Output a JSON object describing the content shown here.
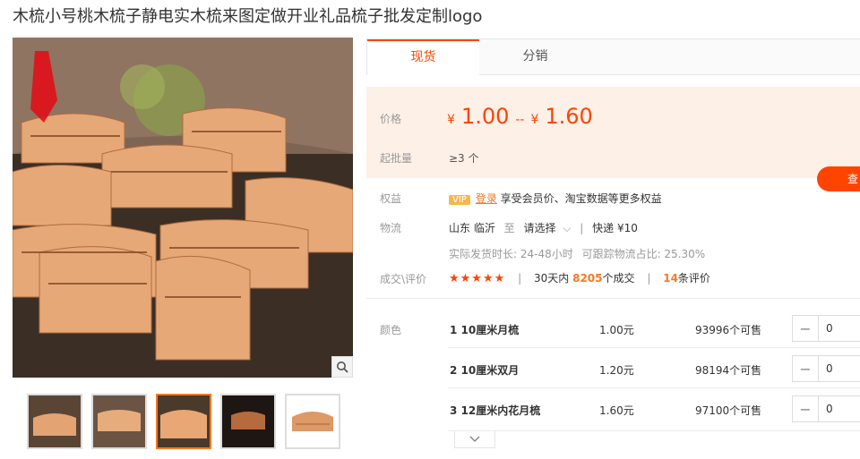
{
  "product": {
    "title": "木梳小号桃木梳子静电实木梳来图定做开业礼品梳子批发定制logo"
  },
  "gallery": {
    "thumb_count": 5,
    "active_index": 2
  },
  "tabs": [
    {
      "label": "现货",
      "active": true
    },
    {
      "label": "分销",
      "active": false
    }
  ],
  "price": {
    "label": "价格",
    "currency": "¥",
    "min": "1.00",
    "max": "1.60",
    "dash": "--"
  },
  "moq": {
    "label": "起批量",
    "value": "≥3 个"
  },
  "stock_button": "查",
  "benefits": {
    "label": "权益",
    "vip": "VIP",
    "login": "登录",
    "text": "享受会员价、淘宝数据等更多权益"
  },
  "logistics": {
    "label": "物流",
    "origin": "山东 临沂",
    "to": "至",
    "select": "请选择",
    "express": "快递 ¥10",
    "ship_time": "实际发货时长: 24-48小时",
    "track_rate": "可跟踪物流占比: 25.30%"
  },
  "reviews": {
    "label": "成交\\评价",
    "stars": "★★★★★",
    "deals_prefix": "30天内",
    "deals_count": "8205",
    "deals_suffix": "个成交",
    "review_count": "14",
    "review_suffix": "条评价"
  },
  "variants": {
    "label": "颜色",
    "rows": [
      {
        "name": "1 10厘米月梳",
        "price": "1.00元",
        "stock": "93996个可售",
        "qty": "0"
      },
      {
        "name": "2 10厘米双月",
        "price": "1.20元",
        "stock": "98194个可售",
        "qty": "0"
      },
      {
        "name": "3 12厘米内花月梳",
        "price": "1.60元",
        "stock": "97100个可售",
        "qty": "0"
      }
    ]
  },
  "colors": {
    "accent": "#ff4400",
    "price_bg": "#fdf0e7"
  }
}
